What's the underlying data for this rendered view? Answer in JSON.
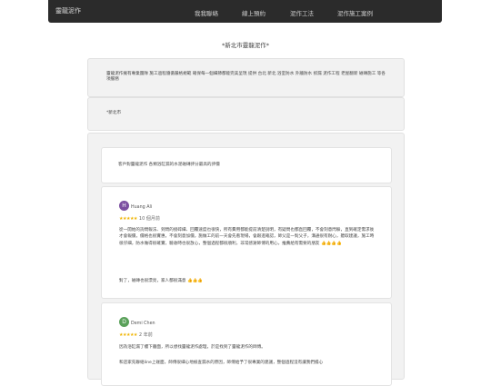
{
  "nav": {
    "brand": "靈龍泥作",
    "links": [
      "我我聯絡",
      "線上預約",
      "泥作工法",
      "泥作施工案例"
    ]
  },
  "page_title": "*新北市靈龍泥作*",
  "intro": {
    "text": "靈龍泥作擁有專業團隊 施工過程遵循嚴格規範 確保每一個細節都能完美呈現 提供 台北 新北 浴室防水 外牆防水 抓漏 泥作工程 老屋翻新 磁磚施工 等各項服務"
  },
  "secondary": {
    "text": "*新北市"
  },
  "reviews_section": {
    "heading": "客戶對靈龍泥作 各類浴缸漏的水泥磁磚評分最高的評價",
    "reviews": [
      {
        "initial": "H",
        "name": "Huang Ali",
        "avatar_color": "#7b4ea0",
        "stars": "★★★★★",
        "meta": "10 個月前",
        "text": "從一開始的詢問報法、到問的接碎細、回覆速度也很快，所有費用都能提前清楚說明，有疑問也都直回覆，不會刻意閃躲，直到確定需求後才會報價，價格也很實惠，不會刻意加價，施做工的前一天會先看現場，會跟進確認，師父是一對父子，溝通很有耐心，聽取建議，施工時很仔細，防水做得很確實，驗收時也很放心，整個過程都很順利，非常感謝師傅的用心，推薦給有需要的朋友 👍👍👍👍",
        "followup": "對了，磁磚也很漂亮，家人都很滿意 👍👍👍"
      },
      {
        "initial": "D",
        "name": "Demi Chen",
        "avatar_color": "#5aa15a",
        "stars": "★★★★★",
        "meta": "2 年前",
        "text": "因為浴缸漏了樓下牆面，所以想找靈龍泥作處理，於是找到了靈龍泥作的師傅。",
        "followup": "和店家先聯絡line上碰面，師傅很細心地檢查漏水的原因，師傅給予了很專業的建議，整個過程沒有讓我們擔心"
      }
    ]
  }
}
